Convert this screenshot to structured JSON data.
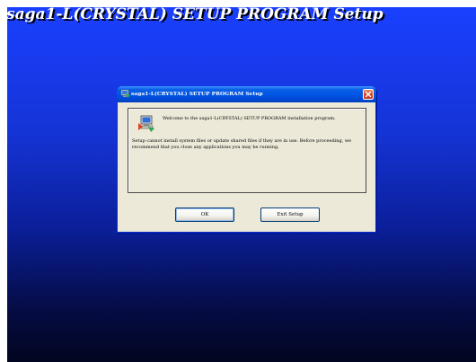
{
  "background": {
    "title": "saga1-L(CRYSTAL) SETUP PROGRAM Setup",
    "gradient_top": "#1a40ff",
    "gradient_bottom": "#020520"
  },
  "dialog": {
    "title": "saga1-L(CRYSTAL) SETUP PROGRAM Setup",
    "welcome_message": "Welcome to the saga1-L(CRYSTAL) SETUP PROGRAM installation program.",
    "warning_message": "Setup cannot install system files or update shared files if they are in use. Before proceeding, we recommend that you close any applications you may be running.",
    "ok_label": "OK",
    "exit_label": "Exit Setup",
    "titlebar_color": "#0054e3",
    "body_color": "#ece9d8",
    "close_color": "#d9462a"
  },
  "icons": {
    "titlebar": "installer-icon",
    "panel": "installer-computer-icon",
    "close": "close-icon"
  }
}
